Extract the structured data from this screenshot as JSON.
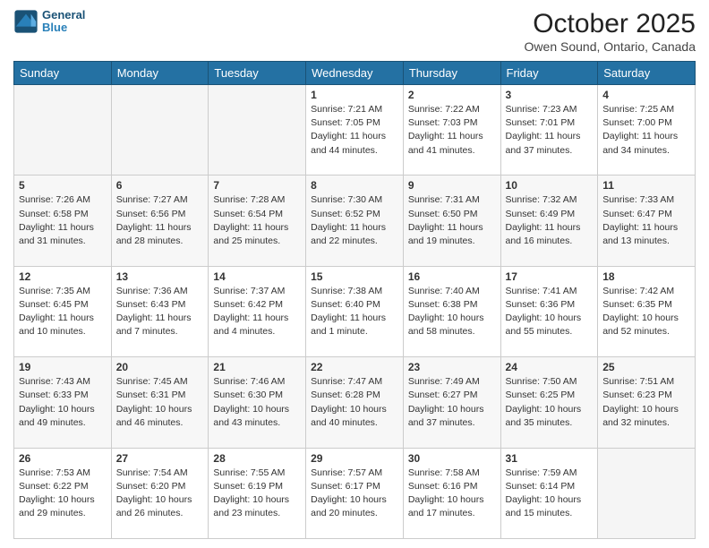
{
  "header": {
    "logo_general": "General",
    "logo_blue": "Blue",
    "title": "October 2025",
    "subtitle": "Owen Sound, Ontario, Canada"
  },
  "days_of_week": [
    "Sunday",
    "Monday",
    "Tuesday",
    "Wednesday",
    "Thursday",
    "Friday",
    "Saturday"
  ],
  "weeks": [
    [
      {
        "day": "",
        "info": ""
      },
      {
        "day": "",
        "info": ""
      },
      {
        "day": "",
        "info": ""
      },
      {
        "day": "1",
        "info": "Sunrise: 7:21 AM\nSunset: 7:05 PM\nDaylight: 11 hours\nand 44 minutes."
      },
      {
        "day": "2",
        "info": "Sunrise: 7:22 AM\nSunset: 7:03 PM\nDaylight: 11 hours\nand 41 minutes."
      },
      {
        "day": "3",
        "info": "Sunrise: 7:23 AM\nSunset: 7:01 PM\nDaylight: 11 hours\nand 37 minutes."
      },
      {
        "day": "4",
        "info": "Sunrise: 7:25 AM\nSunset: 7:00 PM\nDaylight: 11 hours\nand 34 minutes."
      }
    ],
    [
      {
        "day": "5",
        "info": "Sunrise: 7:26 AM\nSunset: 6:58 PM\nDaylight: 11 hours\nand 31 minutes."
      },
      {
        "day": "6",
        "info": "Sunrise: 7:27 AM\nSunset: 6:56 PM\nDaylight: 11 hours\nand 28 minutes."
      },
      {
        "day": "7",
        "info": "Sunrise: 7:28 AM\nSunset: 6:54 PM\nDaylight: 11 hours\nand 25 minutes."
      },
      {
        "day": "8",
        "info": "Sunrise: 7:30 AM\nSunset: 6:52 PM\nDaylight: 11 hours\nand 22 minutes."
      },
      {
        "day": "9",
        "info": "Sunrise: 7:31 AM\nSunset: 6:50 PM\nDaylight: 11 hours\nand 19 minutes."
      },
      {
        "day": "10",
        "info": "Sunrise: 7:32 AM\nSunset: 6:49 PM\nDaylight: 11 hours\nand 16 minutes."
      },
      {
        "day": "11",
        "info": "Sunrise: 7:33 AM\nSunset: 6:47 PM\nDaylight: 11 hours\nand 13 minutes."
      }
    ],
    [
      {
        "day": "12",
        "info": "Sunrise: 7:35 AM\nSunset: 6:45 PM\nDaylight: 11 hours\nand 10 minutes."
      },
      {
        "day": "13",
        "info": "Sunrise: 7:36 AM\nSunset: 6:43 PM\nDaylight: 11 hours\nand 7 minutes."
      },
      {
        "day": "14",
        "info": "Sunrise: 7:37 AM\nSunset: 6:42 PM\nDaylight: 11 hours\nand 4 minutes."
      },
      {
        "day": "15",
        "info": "Sunrise: 7:38 AM\nSunset: 6:40 PM\nDaylight: 11 hours\nand 1 minute."
      },
      {
        "day": "16",
        "info": "Sunrise: 7:40 AM\nSunset: 6:38 PM\nDaylight: 10 hours\nand 58 minutes."
      },
      {
        "day": "17",
        "info": "Sunrise: 7:41 AM\nSunset: 6:36 PM\nDaylight: 10 hours\nand 55 minutes."
      },
      {
        "day": "18",
        "info": "Sunrise: 7:42 AM\nSunset: 6:35 PM\nDaylight: 10 hours\nand 52 minutes."
      }
    ],
    [
      {
        "day": "19",
        "info": "Sunrise: 7:43 AM\nSunset: 6:33 PM\nDaylight: 10 hours\nand 49 minutes."
      },
      {
        "day": "20",
        "info": "Sunrise: 7:45 AM\nSunset: 6:31 PM\nDaylight: 10 hours\nand 46 minutes."
      },
      {
        "day": "21",
        "info": "Sunrise: 7:46 AM\nSunset: 6:30 PM\nDaylight: 10 hours\nand 43 minutes."
      },
      {
        "day": "22",
        "info": "Sunrise: 7:47 AM\nSunset: 6:28 PM\nDaylight: 10 hours\nand 40 minutes."
      },
      {
        "day": "23",
        "info": "Sunrise: 7:49 AM\nSunset: 6:27 PM\nDaylight: 10 hours\nand 37 minutes."
      },
      {
        "day": "24",
        "info": "Sunrise: 7:50 AM\nSunset: 6:25 PM\nDaylight: 10 hours\nand 35 minutes."
      },
      {
        "day": "25",
        "info": "Sunrise: 7:51 AM\nSunset: 6:23 PM\nDaylight: 10 hours\nand 32 minutes."
      }
    ],
    [
      {
        "day": "26",
        "info": "Sunrise: 7:53 AM\nSunset: 6:22 PM\nDaylight: 10 hours\nand 29 minutes."
      },
      {
        "day": "27",
        "info": "Sunrise: 7:54 AM\nSunset: 6:20 PM\nDaylight: 10 hours\nand 26 minutes."
      },
      {
        "day": "28",
        "info": "Sunrise: 7:55 AM\nSunset: 6:19 PM\nDaylight: 10 hours\nand 23 minutes."
      },
      {
        "day": "29",
        "info": "Sunrise: 7:57 AM\nSunset: 6:17 PM\nDaylight: 10 hours\nand 20 minutes."
      },
      {
        "day": "30",
        "info": "Sunrise: 7:58 AM\nSunset: 6:16 PM\nDaylight: 10 hours\nand 17 minutes."
      },
      {
        "day": "31",
        "info": "Sunrise: 7:59 AM\nSunset: 6:14 PM\nDaylight: 10 hours\nand 15 minutes."
      },
      {
        "day": "",
        "info": ""
      }
    ]
  ]
}
